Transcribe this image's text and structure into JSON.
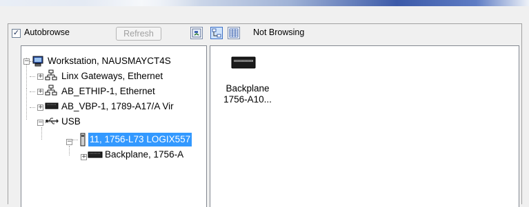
{
  "toolbar": {
    "autobrowse_label": "Autobrowse",
    "autobrowse_checked": true,
    "refresh_label": "Refresh",
    "status_text": "Not Browsing"
  },
  "tree": {
    "workstation": "Workstation, NAUSMAYCT4S",
    "linx_gateways": "Linx Gateways, Ethernet",
    "ab_ethip": "AB_ETHIP-1, Ethernet",
    "ab_vbp": "AB_VBP-1, 1789-A17/A Vir",
    "usb": "USB",
    "controller": "11, 1756-L73 LOGIX557",
    "backplane": "Backplane, 1756-A"
  },
  "detail": {
    "item_line1": "Backplane",
    "item_line2": "1756-A10..."
  }
}
